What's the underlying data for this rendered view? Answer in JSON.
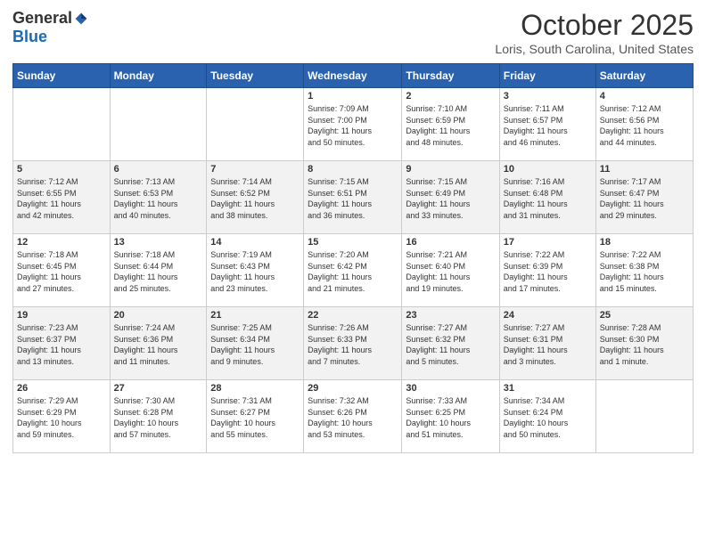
{
  "logo": {
    "general": "General",
    "blue": "Blue"
  },
  "header": {
    "month": "October 2025",
    "location": "Loris, South Carolina, United States"
  },
  "weekdays": [
    "Sunday",
    "Monday",
    "Tuesday",
    "Wednesday",
    "Thursday",
    "Friday",
    "Saturday"
  ],
  "weeks": [
    [
      {
        "day": "",
        "info": ""
      },
      {
        "day": "",
        "info": ""
      },
      {
        "day": "",
        "info": ""
      },
      {
        "day": "1",
        "info": "Sunrise: 7:09 AM\nSunset: 7:00 PM\nDaylight: 11 hours\nand 50 minutes."
      },
      {
        "day": "2",
        "info": "Sunrise: 7:10 AM\nSunset: 6:59 PM\nDaylight: 11 hours\nand 48 minutes."
      },
      {
        "day": "3",
        "info": "Sunrise: 7:11 AM\nSunset: 6:57 PM\nDaylight: 11 hours\nand 46 minutes."
      },
      {
        "day": "4",
        "info": "Sunrise: 7:12 AM\nSunset: 6:56 PM\nDaylight: 11 hours\nand 44 minutes."
      }
    ],
    [
      {
        "day": "5",
        "info": "Sunrise: 7:12 AM\nSunset: 6:55 PM\nDaylight: 11 hours\nand 42 minutes."
      },
      {
        "day": "6",
        "info": "Sunrise: 7:13 AM\nSunset: 6:53 PM\nDaylight: 11 hours\nand 40 minutes."
      },
      {
        "day": "7",
        "info": "Sunrise: 7:14 AM\nSunset: 6:52 PM\nDaylight: 11 hours\nand 38 minutes."
      },
      {
        "day": "8",
        "info": "Sunrise: 7:15 AM\nSunset: 6:51 PM\nDaylight: 11 hours\nand 36 minutes."
      },
      {
        "day": "9",
        "info": "Sunrise: 7:15 AM\nSunset: 6:49 PM\nDaylight: 11 hours\nand 33 minutes."
      },
      {
        "day": "10",
        "info": "Sunrise: 7:16 AM\nSunset: 6:48 PM\nDaylight: 11 hours\nand 31 minutes."
      },
      {
        "day": "11",
        "info": "Sunrise: 7:17 AM\nSunset: 6:47 PM\nDaylight: 11 hours\nand 29 minutes."
      }
    ],
    [
      {
        "day": "12",
        "info": "Sunrise: 7:18 AM\nSunset: 6:45 PM\nDaylight: 11 hours\nand 27 minutes."
      },
      {
        "day": "13",
        "info": "Sunrise: 7:18 AM\nSunset: 6:44 PM\nDaylight: 11 hours\nand 25 minutes."
      },
      {
        "day": "14",
        "info": "Sunrise: 7:19 AM\nSunset: 6:43 PM\nDaylight: 11 hours\nand 23 minutes."
      },
      {
        "day": "15",
        "info": "Sunrise: 7:20 AM\nSunset: 6:42 PM\nDaylight: 11 hours\nand 21 minutes."
      },
      {
        "day": "16",
        "info": "Sunrise: 7:21 AM\nSunset: 6:40 PM\nDaylight: 11 hours\nand 19 minutes."
      },
      {
        "day": "17",
        "info": "Sunrise: 7:22 AM\nSunset: 6:39 PM\nDaylight: 11 hours\nand 17 minutes."
      },
      {
        "day": "18",
        "info": "Sunrise: 7:22 AM\nSunset: 6:38 PM\nDaylight: 11 hours\nand 15 minutes."
      }
    ],
    [
      {
        "day": "19",
        "info": "Sunrise: 7:23 AM\nSunset: 6:37 PM\nDaylight: 11 hours\nand 13 minutes."
      },
      {
        "day": "20",
        "info": "Sunrise: 7:24 AM\nSunset: 6:36 PM\nDaylight: 11 hours\nand 11 minutes."
      },
      {
        "day": "21",
        "info": "Sunrise: 7:25 AM\nSunset: 6:34 PM\nDaylight: 11 hours\nand 9 minutes."
      },
      {
        "day": "22",
        "info": "Sunrise: 7:26 AM\nSunset: 6:33 PM\nDaylight: 11 hours\nand 7 minutes."
      },
      {
        "day": "23",
        "info": "Sunrise: 7:27 AM\nSunset: 6:32 PM\nDaylight: 11 hours\nand 5 minutes."
      },
      {
        "day": "24",
        "info": "Sunrise: 7:27 AM\nSunset: 6:31 PM\nDaylight: 11 hours\nand 3 minutes."
      },
      {
        "day": "25",
        "info": "Sunrise: 7:28 AM\nSunset: 6:30 PM\nDaylight: 11 hours\nand 1 minute."
      }
    ],
    [
      {
        "day": "26",
        "info": "Sunrise: 7:29 AM\nSunset: 6:29 PM\nDaylight: 10 hours\nand 59 minutes."
      },
      {
        "day": "27",
        "info": "Sunrise: 7:30 AM\nSunset: 6:28 PM\nDaylight: 10 hours\nand 57 minutes."
      },
      {
        "day": "28",
        "info": "Sunrise: 7:31 AM\nSunset: 6:27 PM\nDaylight: 10 hours\nand 55 minutes."
      },
      {
        "day": "29",
        "info": "Sunrise: 7:32 AM\nSunset: 6:26 PM\nDaylight: 10 hours\nand 53 minutes."
      },
      {
        "day": "30",
        "info": "Sunrise: 7:33 AM\nSunset: 6:25 PM\nDaylight: 10 hours\nand 51 minutes."
      },
      {
        "day": "31",
        "info": "Sunrise: 7:34 AM\nSunset: 6:24 PM\nDaylight: 10 hours\nand 50 minutes."
      },
      {
        "day": "",
        "info": ""
      }
    ]
  ]
}
